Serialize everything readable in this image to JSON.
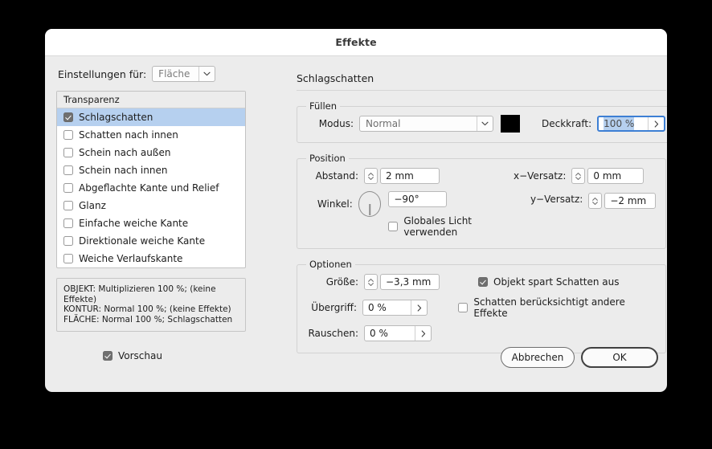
{
  "window": {
    "title": "Effekte"
  },
  "left": {
    "settings_for_label": "Einstellungen für:",
    "settings_for_value": "Fläche",
    "list_header": "Transparenz",
    "items": [
      {
        "label": "Schlagschatten",
        "checked": true,
        "selected": true
      },
      {
        "label": "Schatten nach innen",
        "checked": false,
        "selected": false
      },
      {
        "label": "Schein nach außen",
        "checked": false,
        "selected": false
      },
      {
        "label": "Schein nach innen",
        "checked": false,
        "selected": false
      },
      {
        "label": "Abgeflachte Kante und Relief",
        "checked": false,
        "selected": false
      },
      {
        "label": "Glanz",
        "checked": false,
        "selected": false
      },
      {
        "label": "Einfache weiche Kante",
        "checked": false,
        "selected": false
      },
      {
        "label": "Direktionale weiche Kante",
        "checked": false,
        "selected": false
      },
      {
        "label": "Weiche Verlaufskante",
        "checked": false,
        "selected": false
      }
    ],
    "info_lines": [
      "OBJEKT: Multiplizieren 100 %; (keine Effekte)",
      "KONTUR: Normal 100 %; (keine Effekte)",
      "FLÄCHE: Normal 100 %; Schlagschatten"
    ]
  },
  "right": {
    "panel_title": "Schlagschatten",
    "fill": {
      "legend": "Füllen",
      "mode_label": "Modus:",
      "mode_value": "Normal",
      "color_swatch": "#000000",
      "opacity_label": "Deckkraft:",
      "opacity_value": "100 %"
    },
    "position": {
      "legend": "Position",
      "distance_label": "Abstand:",
      "distance_value": "2 mm",
      "angle_label": "Winkel:",
      "angle_value": "−90°",
      "global_light_label": "Globales Licht verwenden",
      "global_light_checked": false,
      "x_offset_label": "x−Versatz:",
      "x_offset_value": "0 mm",
      "y_offset_label": "y−Versatz:",
      "y_offset_value": "−2 mm"
    },
    "options": {
      "legend": "Optionen",
      "size_label": "Größe:",
      "size_value": "−3,3 mm",
      "spread_label": "Übergriff:",
      "spread_value": "0 %",
      "noise_label": "Rauschen:",
      "noise_value": "0 %",
      "knockout_label": "Objekt spart Schatten aus",
      "knockout_checked": true,
      "honor_label": "Schatten berücksichtigt andere Effekte",
      "honor_checked": false
    }
  },
  "footer": {
    "preview_label": "Vorschau",
    "preview_checked": true,
    "cancel_label": "Abbrechen",
    "ok_label": "OK"
  },
  "colors": {
    "selection_blue": "#b6d0ef",
    "focus_ring": "#3d7fd4",
    "dialog_bg": "#ececec",
    "titlebar_bg": "#ffffff",
    "desktop_bg": "#000000"
  }
}
